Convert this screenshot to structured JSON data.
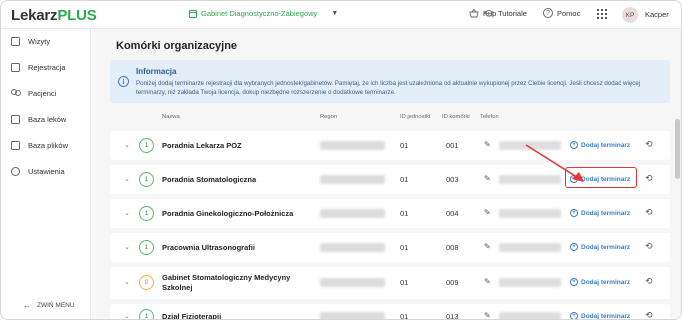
{
  "app": {
    "logo_part1": "Lekarz",
    "logo_part2": "PLUS",
    "clinic": "Gabinet Diagnostyczno-Zabiegowy",
    "nav_shop": "Kup",
    "nav_tutorials": "Tutoriale",
    "nav_help": "Pomoc",
    "avatar_initials": "KP",
    "user_name": "Kacper",
    "accent_color": "#2ea84f"
  },
  "sidebar": {
    "items": [
      {
        "label": "Wizyty",
        "icon": "calendar-icon"
      },
      {
        "label": "Rejestracja",
        "icon": "register-icon"
      },
      {
        "label": "Pacjenci",
        "icon": "patients-icon"
      },
      {
        "label": "Baza leków",
        "icon": "drug-base-icon"
      },
      {
        "label": "Baza plików",
        "icon": "files-icon"
      },
      {
        "label": "Ustawienia",
        "icon": "gear-icon"
      }
    ],
    "collapse_label": "ZWIŃ MENU"
  },
  "main": {
    "title": "Komórki organizacyjne",
    "info": {
      "title": "Informacja",
      "text": "Poniżej dodaj terminarze rejestracji dla wybranych jednostek/gabinetów. Pamiętaj, że ich liczba jest uzależniona od aktualnie wykupionej przez Ciebie licencji. Jeśli chcesz dodać więcej terminarzy, niż zakłada Twoja licencja, dokup niezbędne rozszerzenie o dodatkowe terminarze."
    },
    "columns": [
      "Nazwa",
      "Regon",
      "ID jednostki",
      "ID komórki",
      "Telefon"
    ],
    "add_label": "Dodaj terminarz",
    "rows": [
      {
        "count": "1",
        "name": "Poradnia Lekarza POZ",
        "id_unit": "01",
        "id_cell": "001",
        "badge": "green"
      },
      {
        "count": "1",
        "name": "Poradnia Stomatologiczna",
        "id_unit": "01",
        "id_cell": "003",
        "badge": "green"
      },
      {
        "count": "1",
        "name": "Poradnia Ginekologiczno-Położnicza",
        "id_unit": "01",
        "id_cell": "004",
        "badge": "green"
      },
      {
        "count": "1",
        "name": "Pracownia Ultrasonografii",
        "id_unit": "01",
        "id_cell": "008",
        "badge": "green"
      },
      {
        "count": "0",
        "name": "Gabinet Stomatologiczny Medycyny Szkolnej",
        "id_unit": "01",
        "id_cell": "009",
        "badge": "orange"
      },
      {
        "count": "1",
        "name": "Dział Fizjoterapii",
        "id_unit": "01",
        "id_cell": "013",
        "badge": "green"
      }
    ]
  }
}
